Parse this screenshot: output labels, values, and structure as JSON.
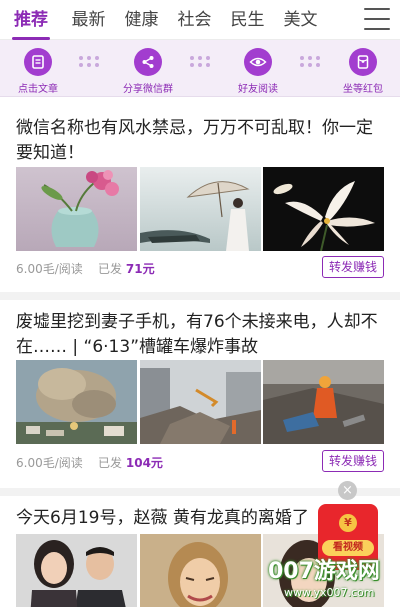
{
  "tabs": [
    {
      "label": "推荐",
      "active": true
    },
    {
      "label": "最新",
      "active": false
    },
    {
      "label": "健康",
      "active": false
    },
    {
      "label": "社会",
      "active": false
    },
    {
      "label": "民生",
      "active": false
    },
    {
      "label": "美文",
      "active": false
    }
  ],
  "menu_icon": "hamburger-menu-icon",
  "steps": [
    {
      "label": "点击文章",
      "icon": "document-icon"
    },
    {
      "label": "分享微信群",
      "icon": "share-icon"
    },
    {
      "label": "好友阅读",
      "icon": "eye-icon"
    },
    {
      "label": "坐等红包",
      "icon": "red-packet-icon"
    }
  ],
  "articles": [
    {
      "title": "微信名称也有风水禁忌，万万不可乱取！你一定要知道！",
      "images": [
        "vase-with-flowers-photo",
        "woman-with-umbrella-photo",
        "lily-flowers-photo"
      ],
      "price": "6.00毛/阅读",
      "sent_prefix": "已发",
      "sent_value": "71元",
      "share_label": "转发赚钱"
    },
    {
      "title": "废墟里挖到妻子手机，有76个未接来电，人却不在…… | “6·13”槽罐车爆炸事故",
      "images": [
        "explosion-smoke-photo",
        "collapsed-buildings-photo",
        "rescue-workers-photo"
      ],
      "price": "6.00毛/阅读",
      "sent_prefix": "已发",
      "sent_value": "104元",
      "share_label": "转发赚钱"
    },
    {
      "title": "今天6月19号，赵薇 黄有龙真的离婚了",
      "images": [
        "couple-portrait-photo",
        "crying-woman-photo",
        "woman-portrait-photo"
      ]
    }
  ],
  "float_ad": {
    "close_symbol": "×",
    "coin_symbol": "¥",
    "label": "看视频"
  },
  "watermark": {
    "main": "007游戏网",
    "sub": "www.yx007.com"
  },
  "colors": {
    "accent": "#8c2bb5",
    "step_bg": "#f4edf8",
    "red_packet": "#e8262c"
  }
}
